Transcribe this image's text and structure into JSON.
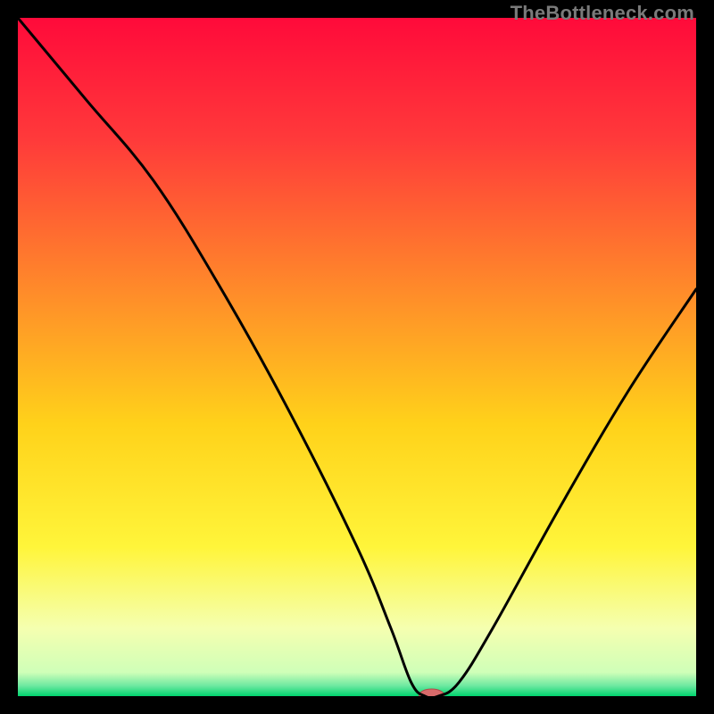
{
  "watermark": "TheBottleneck.com",
  "chart_data": {
    "type": "line",
    "title": "",
    "xlabel": "",
    "ylabel": "",
    "xlim": [
      0,
      100
    ],
    "ylim": [
      0,
      100
    ],
    "grid": false,
    "legend": false,
    "x": [
      0,
      10,
      20,
      30,
      40,
      50,
      55,
      58,
      60,
      62,
      65,
      70,
      80,
      90,
      100
    ],
    "values": [
      100,
      88,
      76,
      60,
      42,
      22,
      10,
      2,
      0,
      0,
      2,
      10,
      28,
      45,
      60
    ],
    "background_gradient": {
      "stops": [
        {
          "offset": 0.0,
          "color": "#ff0a3a"
        },
        {
          "offset": 0.18,
          "color": "#ff3a3a"
        },
        {
          "offset": 0.4,
          "color": "#ff8a2a"
        },
        {
          "offset": 0.6,
          "color": "#ffd21a"
        },
        {
          "offset": 0.78,
          "color": "#fff53a"
        },
        {
          "offset": 0.9,
          "color": "#f5ffb0"
        },
        {
          "offset": 0.965,
          "color": "#cfffb8"
        },
        {
          "offset": 0.985,
          "color": "#6be8a0"
        },
        {
          "offset": 1.0,
          "color": "#00d46e"
        }
      ]
    },
    "marker": {
      "x": 61,
      "y": 0,
      "rx": 14,
      "ry": 7,
      "fill": "#d86a6a",
      "stroke": "#b24a4a"
    }
  }
}
